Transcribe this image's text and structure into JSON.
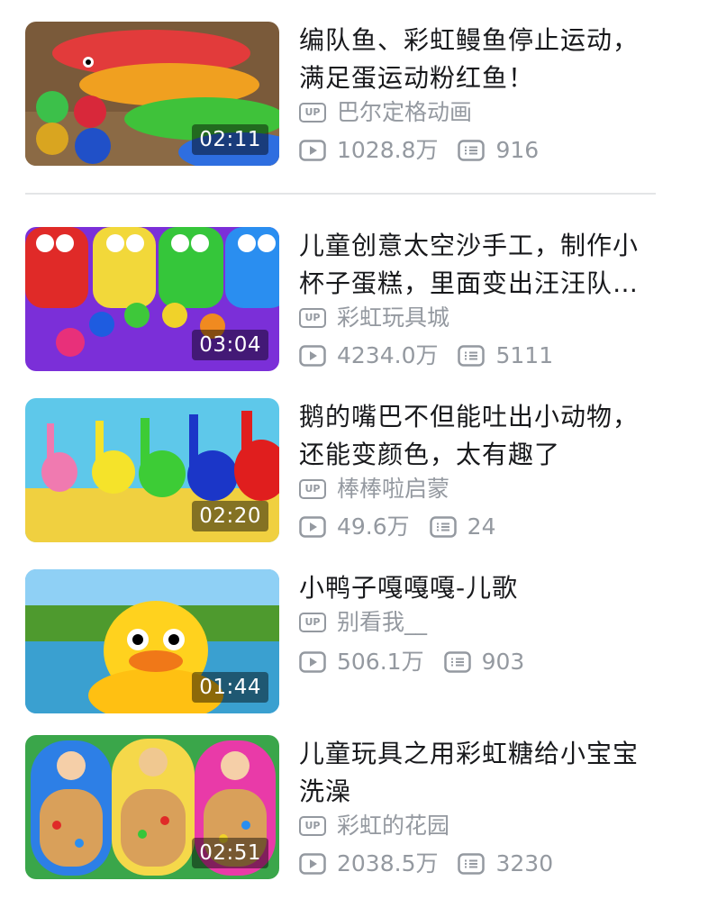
{
  "videos": [
    {
      "title": "编队鱼、彩虹鳗鱼停止运动，满足蛋运动粉红鱼！",
      "uploader": "巴尔定格动画",
      "views": "1028.8万",
      "comments": "916",
      "duration": "02:11"
    },
    {
      "title": "儿童创意太空沙手工，制作小杯子蛋糕，里面变出汪汪队…",
      "uploader": "彩虹玩具城",
      "views": "4234.0万",
      "comments": "5111",
      "duration": "03:04"
    },
    {
      "title": "鹅的嘴巴不但能吐出小动物，还能变颜色，太有趣了",
      "uploader": "棒棒啦启蒙",
      "views": "49.6万",
      "comments": "24",
      "duration": "02:20"
    },
    {
      "title": "小鸭子嘎嘎嘎-儿歌",
      "uploader": "别看我__",
      "views": "506.1万",
      "comments": "903",
      "duration": "01:44"
    },
    {
      "title": "儿童玩具之用彩虹糖给小宝宝洗澡",
      "uploader": "彩虹的花园",
      "views": "2038.5万",
      "comments": "3230",
      "duration": "02:51"
    }
  ],
  "badge": {
    "up_text": "UP"
  },
  "icons": {
    "play": "play-count-icon",
    "comment": "danmaku-comment-icon"
  },
  "colors": {
    "meta_gray": "#9499a0",
    "title_black": "#18191c",
    "divider": "#e3e5e7"
  }
}
